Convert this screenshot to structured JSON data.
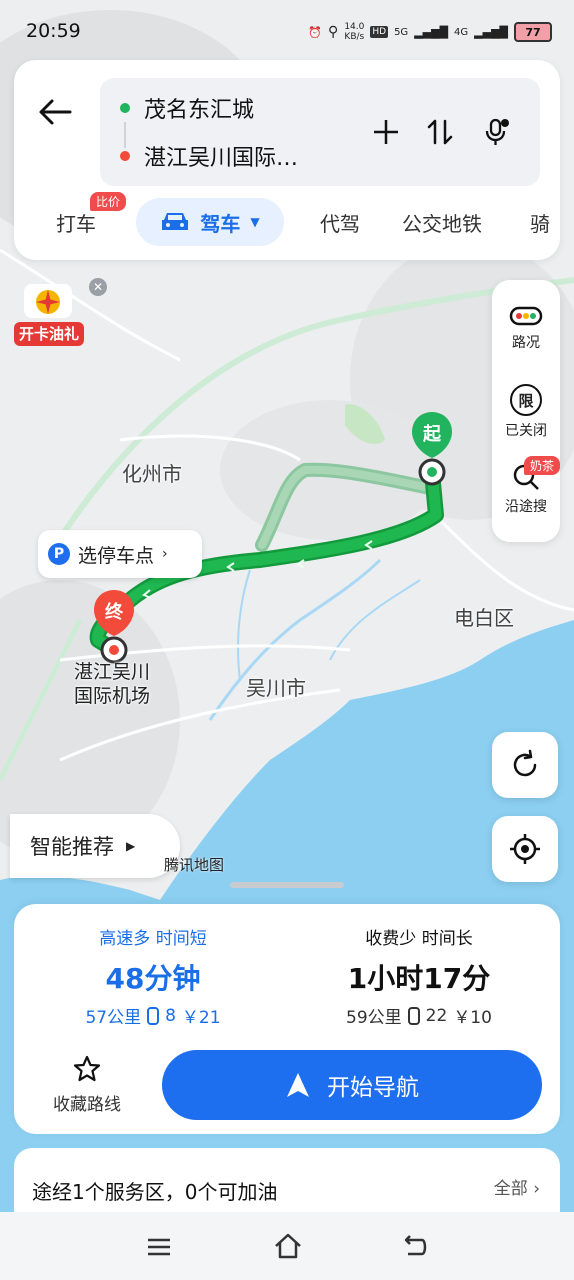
{
  "status_bar": {
    "time": "20:59",
    "net_speed_value": "14.0",
    "net_speed_unit": "KB/s",
    "hd_label": "HD",
    "signal_1": "5G",
    "signal_2": "4G",
    "battery": "77",
    "icons": [
      "alarm-icon",
      "location-icon",
      "hd-icon",
      "signal-icon",
      "battery-icon"
    ]
  },
  "route": {
    "origin": "茂名东汇城",
    "destination": "湛江吴川国际…",
    "origin_color": "#22b35e",
    "destination_color": "#f24b3b"
  },
  "tabs": [
    {
      "label": "打车",
      "badge": "比价"
    },
    {
      "label": "驾车",
      "active": true
    },
    {
      "label": "代驾"
    },
    {
      "label": "公交地铁"
    },
    {
      "label": "骑"
    }
  ],
  "side_panel": {
    "traffic_label": "路况",
    "restriction_icon_text": "限",
    "restriction_label": "已关闭",
    "search_label": "沿途搜",
    "search_badge": "奶茶"
  },
  "map": {
    "labels": {
      "huazhou": "化州市",
      "dianbai": "电白区",
      "wuchuan": "吴川市",
      "airport_line1": "湛江吴川",
      "airport_line2": "国际机场"
    },
    "start_marker": "起",
    "end_marker": "终",
    "parking_icon": "P",
    "parking_label": "选停车点",
    "promo_label": "开卡油礼",
    "smart_recommend": "智能推荐",
    "watermark": "腾讯地图",
    "route_color": "#1fb74f",
    "alt_route_color": "#8cc7a0",
    "water_color": "#8ccff1"
  },
  "route_options": [
    {
      "tag": "高速多 时间短",
      "time": "48分钟",
      "distance": "57公里",
      "lights": "8",
      "cost": "￥21",
      "selected": true
    },
    {
      "tag": "收费少 时间长",
      "time": "1小时17分",
      "distance": "59公里",
      "lights": "22",
      "cost": "￥10",
      "selected": false
    }
  ],
  "actions": {
    "favorite_label": "收藏路线",
    "start_nav_label": "开始导航",
    "accent": "#1e6ff0"
  },
  "service": {
    "text": "途经1个服务区，0个可加油",
    "more_label": "全部"
  }
}
